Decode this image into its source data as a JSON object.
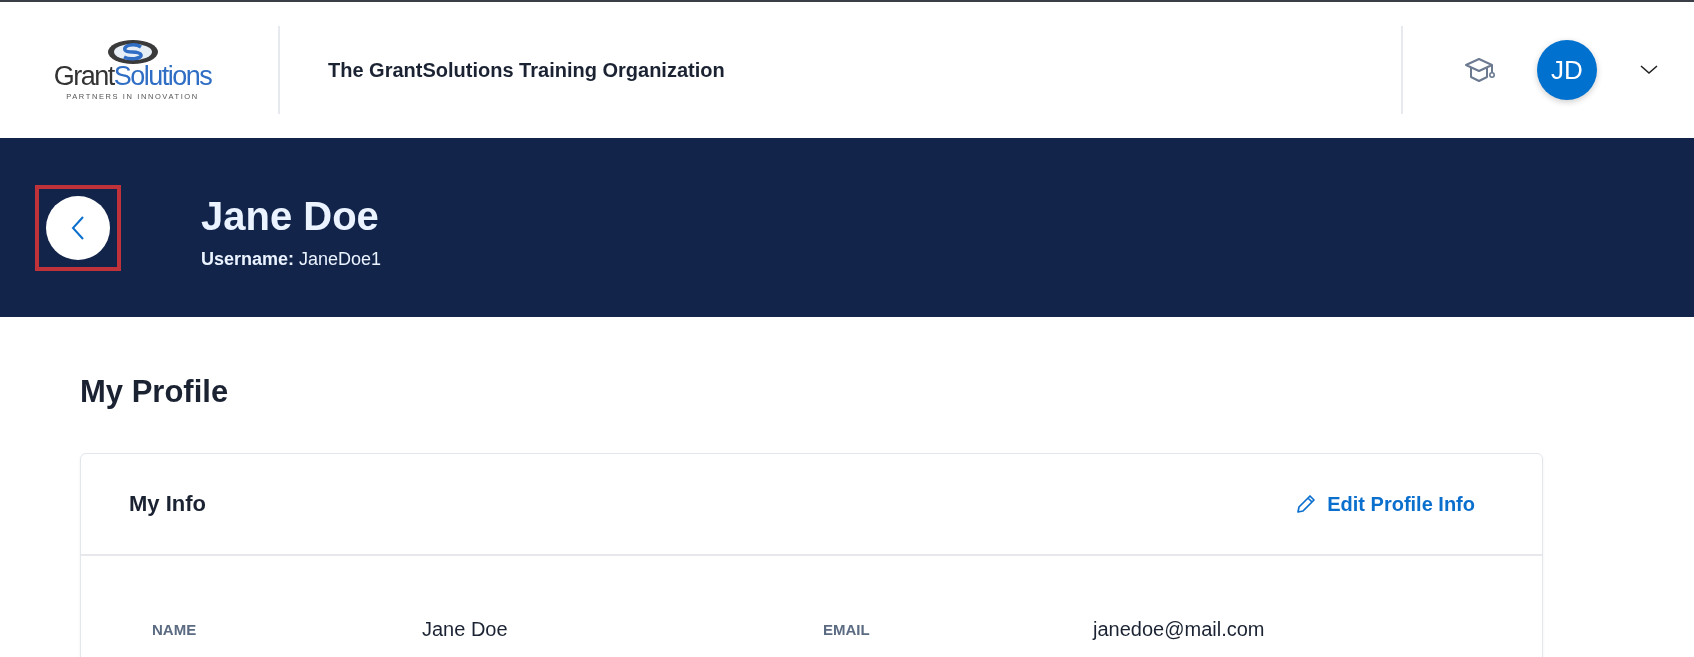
{
  "header": {
    "logo": {
      "wordmark": [
        "Grant",
        "Solutions"
      ],
      "tagline": "PARTNERS IN INNOVATION"
    },
    "organization": "The GrantSolutions Training Organization",
    "avatar": "JD"
  },
  "banner": {
    "back_button": {
      "highlighted": true
    },
    "name": "Jane Doe",
    "username_label": "Username:",
    "username": "JaneDoe1"
  },
  "page_title": "My Profile",
  "card": {
    "title": "My Info",
    "edit_link": "Edit Profile Info",
    "fields": [
      {
        "label": "NAME",
        "value": "Jane Doe"
      },
      {
        "label": "EMAIL",
        "value": "janedoe@mail.com"
      }
    ]
  }
}
